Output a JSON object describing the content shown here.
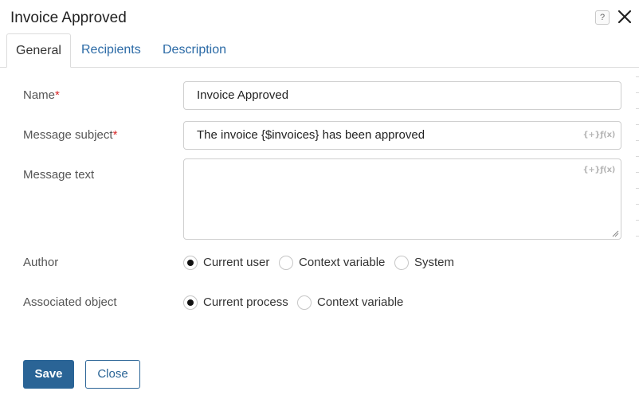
{
  "dialog": {
    "title": "Invoice Approved",
    "help_icon": "question-icon",
    "close_icon": "close-icon"
  },
  "tabs": [
    {
      "label": "General",
      "active": true
    },
    {
      "label": "Recipients",
      "active": false
    },
    {
      "label": "Description",
      "active": false
    }
  ],
  "form": {
    "name": {
      "label": "Name",
      "required_mark": "*",
      "value": "Invoice Approved"
    },
    "subject": {
      "label": "Message subject",
      "required_mark": "*",
      "value": "The invoice {$invoices} has been approved",
      "var_hint": "{+}ƒ(x)"
    },
    "message": {
      "label": "Message text",
      "value": "",
      "var_hint": "{+}ƒ(x)"
    },
    "author": {
      "label": "Author",
      "options": [
        "Current user",
        "Context variable",
        "System"
      ],
      "selected": "Current user"
    },
    "associated": {
      "label": "Associated object",
      "options": [
        "Current process",
        "Context variable"
      ],
      "selected": "Current process"
    }
  },
  "buttons": {
    "save": "Save",
    "close": "Close"
  },
  "colors": {
    "accent": "#2a6496",
    "link": "#2b6aa6",
    "required": "#d9292a"
  }
}
